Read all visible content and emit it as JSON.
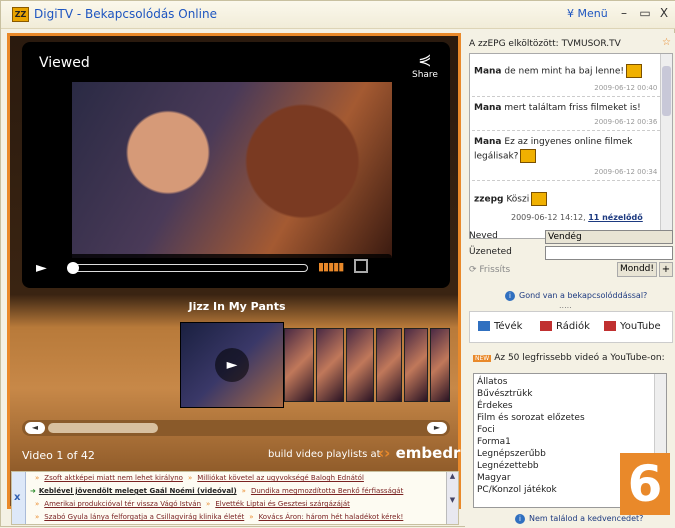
{
  "window": {
    "logo_text": "ZZ",
    "title": "DigiTV - Bekapcsolódás Online",
    "menu_label": "¥ Menü",
    "minimize": "–",
    "maximize": "▭",
    "close": "X"
  },
  "player": {
    "viewed_label": "Viewed",
    "share_label": "Share",
    "play_icon": "►",
    "video_title": "Jizz In My Pants",
    "video_count": "Video 1 of 42",
    "build_text": "build video playlists at",
    "embedr_text": "embedr",
    "progress": 0.0
  },
  "news": {
    "rows": [
      {
        "a": "Zsoft aktképei miatt nem lehet királyno",
        "b": "Milliókat követel az ugyvokségé Balogh Ednától"
      },
      {
        "a": "Keblével jövendölt meleget Gaál Noémi (videóval)",
        "b": "Dundika megmozdította Benkő férfiasságát"
      },
      {
        "a": "Amerikai produkcióval tér vissza Vágó István",
        "b": "Elvették Liptai és Gesztesi szárgázáját"
      },
      {
        "a": "Szabó Gyula lánya felforgatja a Csillagvirág klinika életét",
        "b": "Kovács Áron: három hét haladékot kérek!"
      }
    ],
    "close_label": "x"
  },
  "chat": {
    "header": "A zzEPG elköltözött: TVMUSOR.TV",
    "messages": [
      {
        "user": "Mana",
        "text": "de nem mint ha baj lenne!",
        "time": "2009-06-12 00:40 n"
      },
      {
        "user": "Mana",
        "text": "mert találtam friss filmeket is!",
        "time": "2009-06-12 00:36 n"
      },
      {
        "user": "Mana",
        "text": "Ez az ingyenes online filmek legálisak?",
        "time": "2009-06-12 00:34 n"
      },
      {
        "user": "zzepg",
        "text": "Köszi",
        "time": ""
      }
    ],
    "view_info": "2009-06-12 14:12,",
    "view_link": "11 nézelődő",
    "name_label": "Neved",
    "name_value": "Vendég",
    "message_label": "Üzeneted",
    "message_value": "",
    "refresh_label": "Frissíts",
    "send_label": "Mondd!",
    "plus_label": "+",
    "problem_text": "Gond van a bekapcsolóddással?",
    "dots": "....."
  },
  "tabs": [
    {
      "label": "Tévék",
      "icon": "tv-icon",
      "color": "#3070c0"
    },
    {
      "label": "Rádiók",
      "icon": "speaker-icon",
      "color": "#c03030"
    },
    {
      "label": "YouTube",
      "icon": "youtube-icon",
      "color": "#c03030"
    }
  ],
  "youtube": {
    "badge": "NEW",
    "heading": "Az 50 legfrissebb videó a YouTube-on:",
    "items": [
      "Állatos",
      "Bűvésztrükk",
      "Érdekes",
      "Film és sorozat előzetes",
      "Foci",
      "Forma1",
      "Legnépszerűbb",
      "Legnézettebb",
      "Magyar",
      "PC/Konzol játékok"
    ],
    "number_badge": "6",
    "not_found": "Nem találod a kedvencedet?"
  },
  "colors": {
    "accent": "#e9892a",
    "link": "#1d55c0"
  }
}
